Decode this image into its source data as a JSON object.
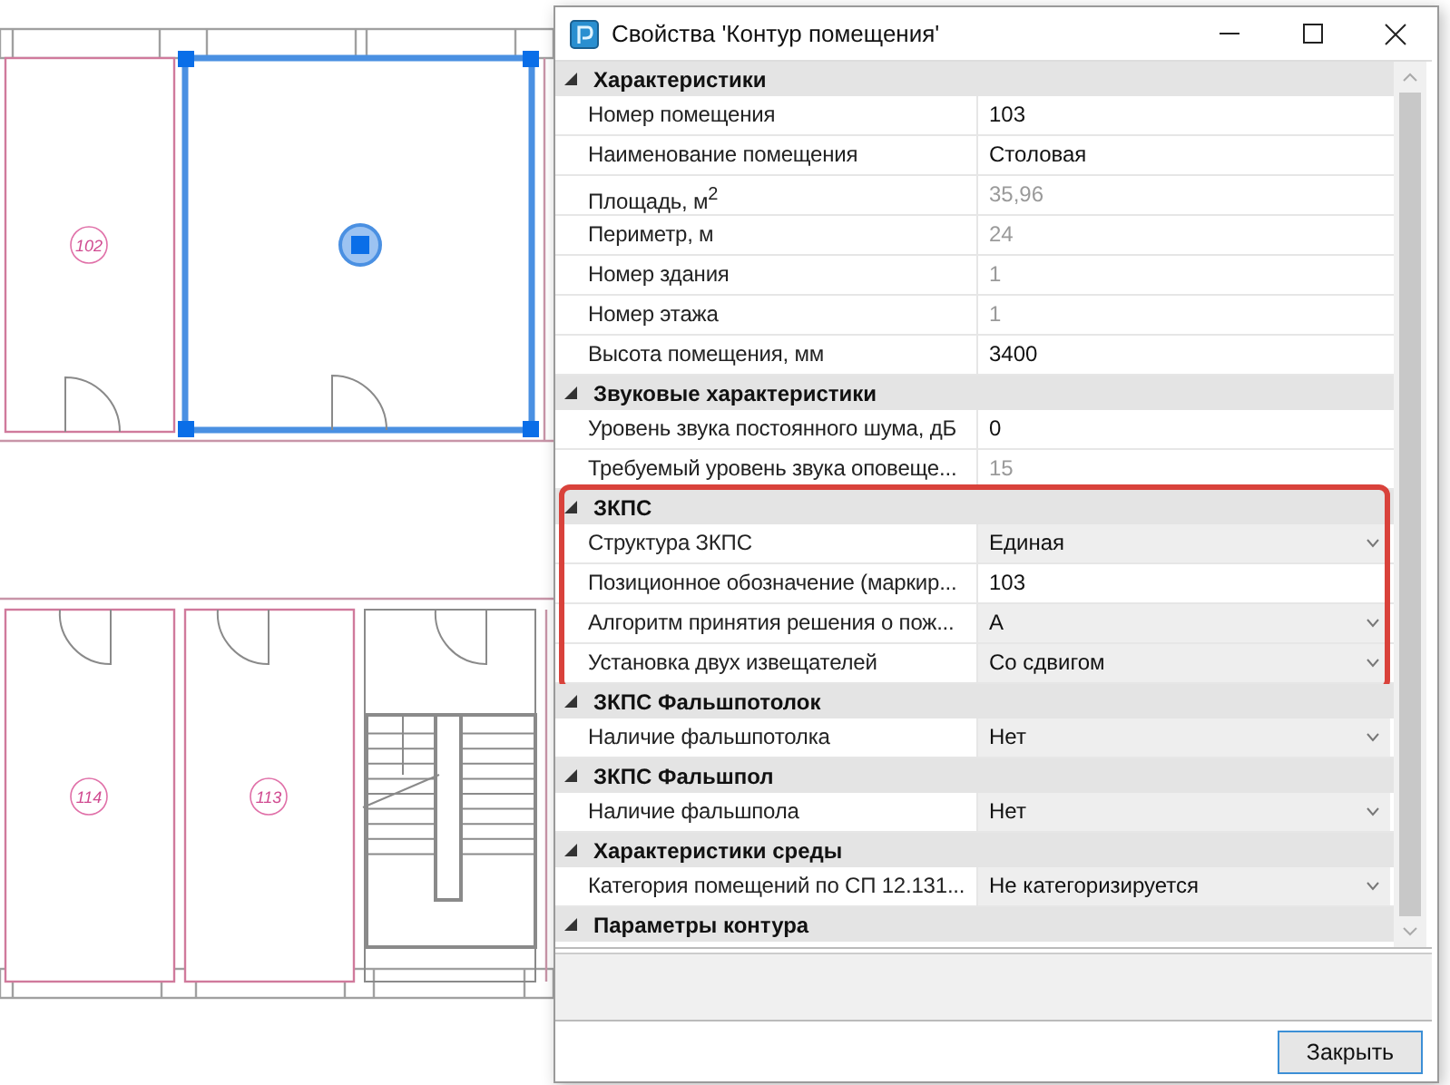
{
  "plan": {
    "rooms": [
      {
        "label": "102",
        "selected": false
      },
      {
        "selected": true
      },
      {
        "label": "114",
        "selected": false
      },
      {
        "label": "113",
        "selected": false
      }
    ]
  },
  "window": {
    "title": "Свойства 'Контур помещения'"
  },
  "categories": [
    {
      "title": "Характеристики",
      "expanded": true,
      "highlighted": false,
      "rows": [
        {
          "label": "Номер помещения",
          "value": "103",
          "kind": "text"
        },
        {
          "label": "Наименование помещения",
          "value": "Столовая",
          "kind": "text"
        },
        {
          "label": "Площадь, м$^{2}$",
          "value": "35,96",
          "kind": "readonly"
        },
        {
          "label": "Периметр, м",
          "value": "24",
          "kind": "readonly"
        },
        {
          "label": "Номер здания",
          "value": "1",
          "kind": "readonly"
        },
        {
          "label": "Номер этажа",
          "value": "1",
          "kind": "readonly"
        },
        {
          "label": "Высота помещения, мм",
          "value": "3400",
          "kind": "text"
        }
      ]
    },
    {
      "title": "Звуковые характеристики",
      "expanded": true,
      "highlighted": false,
      "rows": [
        {
          "label": "Уровень звука постоянного шума, дБ",
          "value": "0",
          "kind": "text"
        },
        {
          "label": "Требуемый уровень звука оповеще...",
          "value": "15",
          "kind": "readonly"
        }
      ]
    },
    {
      "title": "ЗКПС",
      "expanded": true,
      "highlighted": true,
      "rows": [
        {
          "label": "Структура ЗКПС",
          "value": "Единая",
          "kind": "dropdown"
        },
        {
          "label": "Позиционное обозначение (маркир...",
          "value": "103",
          "kind": "text"
        },
        {
          "label": "Алгоритм принятия решения о пож...",
          "value": "А",
          "kind": "dropdown"
        },
        {
          "label": "Установка двух извещателей",
          "value": "Со сдвигом",
          "kind": "dropdown"
        }
      ]
    },
    {
      "title": "ЗКПС Фальшпотолок",
      "expanded": true,
      "highlighted": false,
      "rows": [
        {
          "label": "Наличие фальшпотолка",
          "value": "Нет",
          "kind": "dropdown"
        }
      ]
    },
    {
      "title": "ЗКПС Фальшпол",
      "expanded": true,
      "highlighted": false,
      "rows": [
        {
          "label": "Наличие фальшпола",
          "value": "Нет",
          "kind": "dropdown"
        }
      ]
    },
    {
      "title": "Характеристики среды",
      "expanded": true,
      "highlighted": false,
      "rows": [
        {
          "label": "Категория помещений по СП 12.131...",
          "value": "Не категоризируется",
          "kind": "dropdown"
        }
      ]
    },
    {
      "title": "Параметры контура",
      "expanded": true,
      "highlighted": false
    }
  ],
  "buttons": {
    "close": "Закрыть"
  }
}
